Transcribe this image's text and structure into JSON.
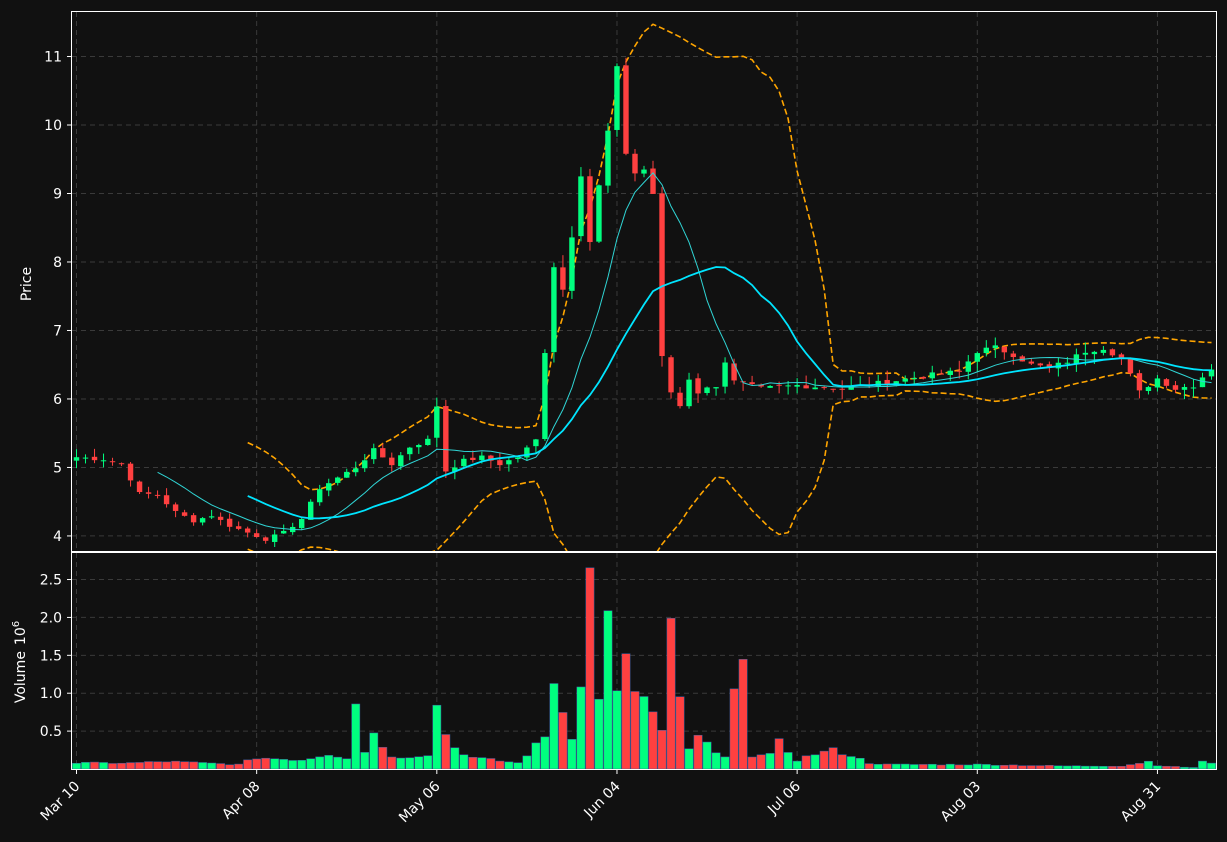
{
  "chart_data": {
    "type": "candlestick",
    "price_panel": {
      "ylabel": "Price",
      "ylim": [
        3.78,
        11.65
      ],
      "yticks": [
        4,
        5,
        6,
        7,
        8,
        9,
        10,
        11
      ],
      "grid": true
    },
    "volume_panel": {
      "ylabel": "Volume",
      "ylabel_exp": "10",
      "ylabel_sup": "6",
      "ylim": [
        0,
        2.85
      ],
      "yticks": [
        0.5,
        1.0,
        1.5,
        2.0,
        2.5
      ],
      "ytick_labels": [
        "0.5",
        "1.0",
        "1.5",
        "2.0",
        "2.5"
      ],
      "unit_multiplier": 1000000
    },
    "xticks": [
      {
        "i": 0,
        "label": "Mar 10"
      },
      {
        "i": 20,
        "label": "Apr 08"
      },
      {
        "i": 40,
        "label": "May 06"
      },
      {
        "i": 60,
        "label": "Jun 04"
      },
      {
        "i": 80,
        "label": "Jul 06"
      },
      {
        "i": 100,
        "label": "Aug 03"
      },
      {
        "i": 120,
        "label": "Aug 31"
      }
    ],
    "colors": {
      "up": "#00ff7f",
      "down": "#ff4040",
      "ma_fast": "#30d5d5",
      "ma_slow": "#00e5ff",
      "bands": "#ffa500",
      "background": "#111111",
      "grid": "#3a3a3a"
    },
    "close_anchors": [
      [
        0,
        5.15
      ],
      [
        3,
        5.12
      ],
      [
        5,
        5.05
      ],
      [
        7,
        4.62
      ],
      [
        9,
        4.6
      ],
      [
        11,
        4.35
      ],
      [
        13,
        4.22
      ],
      [
        15,
        4.3
      ],
      [
        17,
        4.15
      ],
      [
        19,
        4.05
      ],
      [
        21,
        3.95
      ],
      [
        23,
        4.05
      ],
      [
        25,
        4.25
      ],
      [
        27,
        4.7
      ],
      [
        29,
        4.85
      ],
      [
        31,
        5.0
      ],
      [
        33,
        5.25
      ],
      [
        35,
        5.05
      ],
      [
        37,
        5.3
      ],
      [
        39,
        5.4
      ],
      [
        40,
        5.9
      ],
      [
        41,
        4.95
      ],
      [
        43,
        5.1
      ],
      [
        45,
        5.15
      ],
      [
        47,
        5.05
      ],
      [
        49,
        5.15
      ],
      [
        51,
        5.4
      ],
      [
        52,
        6.7
      ],
      [
        53,
        7.95
      ],
      [
        54,
        7.6
      ],
      [
        55,
        8.4
      ],
      [
        56,
        9.3
      ],
      [
        57,
        8.3
      ],
      [
        58,
        9.1
      ],
      [
        59,
        9.9
      ],
      [
        60,
        10.8
      ],
      [
        61,
        9.6
      ],
      [
        62,
        9.3
      ],
      [
        63,
        9.35
      ],
      [
        64,
        9.0
      ],
      [
        65,
        6.6
      ],
      [
        66,
        6.1
      ],
      [
        67,
        5.9
      ],
      [
        68,
        6.3
      ],
      [
        69,
        6.1
      ],
      [
        70,
        6.15
      ],
      [
        71,
        6.2
      ],
      [
        72,
        6.55
      ],
      [
        73,
        6.25
      ],
      [
        76,
        6.15
      ],
      [
        80,
        6.2
      ],
      [
        85,
        6.15
      ],
      [
        90,
        6.25
      ],
      [
        95,
        6.35
      ],
      [
        98,
        6.4
      ],
      [
        100,
        6.7
      ],
      [
        102,
        6.75
      ],
      [
        104,
        6.65
      ],
      [
        106,
        6.5
      ],
      [
        108,
        6.45
      ],
      [
        110,
        6.55
      ],
      [
        112,
        6.7
      ],
      [
        114,
        6.75
      ],
      [
        116,
        6.6
      ],
      [
        118,
        6.1
      ],
      [
        120,
        6.3
      ],
      [
        122,
        6.15
      ],
      [
        124,
        6.2
      ],
      [
        126,
        6.45
      ]
    ],
    "volume_anchors": [
      [
        0,
        0.08
      ],
      [
        6,
        0.08
      ],
      [
        10,
        0.1
      ],
      [
        18,
        0.06
      ],
      [
        20,
        0.15
      ],
      [
        25,
        0.12
      ],
      [
        28,
        0.2
      ],
      [
        30,
        0.15
      ],
      [
        31,
        0.92
      ],
      [
        32,
        0.22
      ],
      [
        33,
        0.5
      ],
      [
        35,
        0.15
      ],
      [
        38,
        0.18
      ],
      [
        39,
        0.2
      ],
      [
        40,
        0.82
      ],
      [
        41,
        0.48
      ],
      [
        42,
        0.28
      ],
      [
        44,
        0.15
      ],
      [
        49,
        0.08
      ],
      [
        52,
        0.42
      ],
      [
        53,
        1.22
      ],
      [
        54,
        0.75
      ],
      [
        55,
        0.45
      ],
      [
        56,
        1.22
      ],
      [
        57,
        2.55
      ],
      [
        58,
        0.88
      ],
      [
        59,
        2.3
      ],
      [
        60,
        0.95
      ],
      [
        61,
        1.43
      ],
      [
        62,
        0.92
      ],
      [
        63,
        1.0
      ],
      [
        64,
        0.72
      ],
      [
        65,
        0.5
      ],
      [
        66,
        1.85
      ],
      [
        67,
        0.85
      ],
      [
        68,
        0.25
      ],
      [
        69,
        0.46
      ],
      [
        70,
        0.32
      ],
      [
        71,
        0.2
      ],
      [
        72,
        0.15
      ],
      [
        74,
        1.7
      ],
      [
        75,
        0.18
      ],
      [
        77,
        0.18
      ],
      [
        78,
        0.35
      ],
      [
        80,
        0.12
      ],
      [
        82,
        0.2
      ],
      [
        84,
        0.25
      ],
      [
        86,
        0.18
      ],
      [
        88,
        0.08
      ],
      [
        90,
        0.06
      ],
      [
        100,
        0.06
      ],
      [
        105,
        0.05
      ],
      [
        110,
        0.04
      ],
      [
        116,
        0.04
      ],
      [
        118,
        0.08
      ],
      [
        119,
        0.1
      ],
      [
        120,
        0.05
      ],
      [
        122,
        0.03
      ],
      [
        124,
        0.02
      ],
      [
        125,
        0.1
      ],
      [
        126,
        0.07
      ]
    ],
    "bar_count": 127
  }
}
